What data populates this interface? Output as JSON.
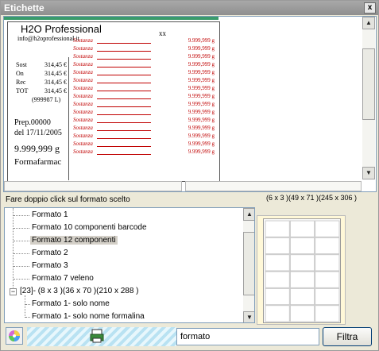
{
  "window": {
    "title": "Etichette",
    "close_label": "x"
  },
  "preview": {
    "title": "H2O Professional",
    "code": "xx",
    "email": "info@h2oprofessional.it",
    "prices": [
      {
        "k": "Sost",
        "v": "314,45 €"
      },
      {
        "k": "On",
        "v": "314,45 €"
      },
      {
        "k": "Rec",
        "v": "314,45 €"
      },
      {
        "k": "TOT",
        "v": "314,45 €"
      }
    ],
    "total_paren": "(999987 L)",
    "prep": "Prep.00000",
    "date": "del 17/11/2005",
    "weight": "9.999,999 g",
    "company": "Formafarmac",
    "component_name": "Sostanza",
    "component_qty": "9.999,999 g",
    "component_count": 15
  },
  "hint": "Fare doppio click sul formato scelto",
  "format_info": "(6 x 3 )(49 x 71 )(245 x 306 )",
  "tree": {
    "items": [
      {
        "label": "Formato 1",
        "selected": false
      },
      {
        "label": "Formato 10 componenti barcode",
        "selected": false
      },
      {
        "label": "Formato 12 componenti",
        "selected": true
      },
      {
        "label": "Formato 2",
        "selected": false
      },
      {
        "label": "Formato 3",
        "selected": false
      },
      {
        "label": "Formato 7 veleno",
        "selected": false
      }
    ],
    "group": {
      "label": "[23]- (8 x 3 )(36 x 70 )(210 x 288 )",
      "expander": "−"
    },
    "group_items": [
      {
        "label": "Formato 1- solo nome"
      },
      {
        "label": "Formato 1- solo nome formalina"
      }
    ]
  },
  "grid": {
    "rows": 6,
    "cols": 3
  },
  "bottom": {
    "search_value": "formato",
    "filter_label": "Filtra",
    "icons": [
      "color-wheel-icon",
      "printer-icon"
    ]
  },
  "colors": {
    "component_red": "#c00000",
    "titlebar": "#9a9a9a",
    "grid_bg": "#fff8d8"
  }
}
